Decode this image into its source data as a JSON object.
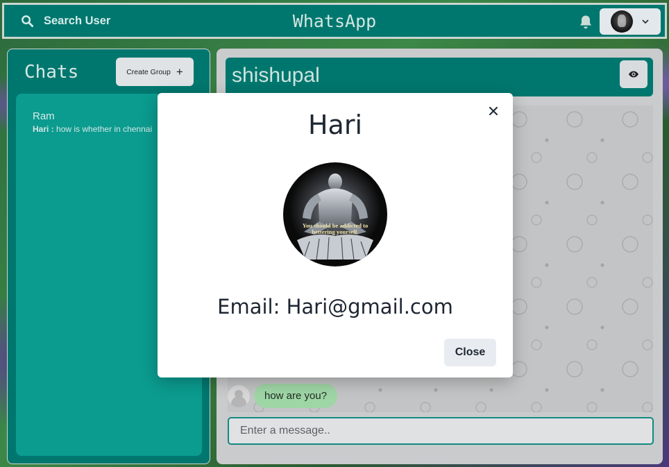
{
  "header": {
    "search_label": "Search User",
    "app_title": "WhatsApp"
  },
  "sidebar": {
    "title": "Chats",
    "create_group_label": "Create Group",
    "chats": [
      {
        "name": "Ram",
        "sender": "Hari :",
        "preview": "how is whether in chennai"
      }
    ]
  },
  "conversation": {
    "contact_name": "shishupal",
    "messages": [
      {
        "text": "how are you?"
      }
    ],
    "input_placeholder": "Enter a message.."
  },
  "modal": {
    "title": "Hari",
    "email": "Email: Hari@gmail.com",
    "image_caption_line1": "You should be addicted to",
    "image_caption_line2": "bettering yourself.",
    "close_label": "Close"
  },
  "colors": {
    "primary": "#00776e",
    "chat_list_bg": "#0b9b8f",
    "bubble": "#9fd6a6",
    "modal_bg": "#ffffff"
  }
}
